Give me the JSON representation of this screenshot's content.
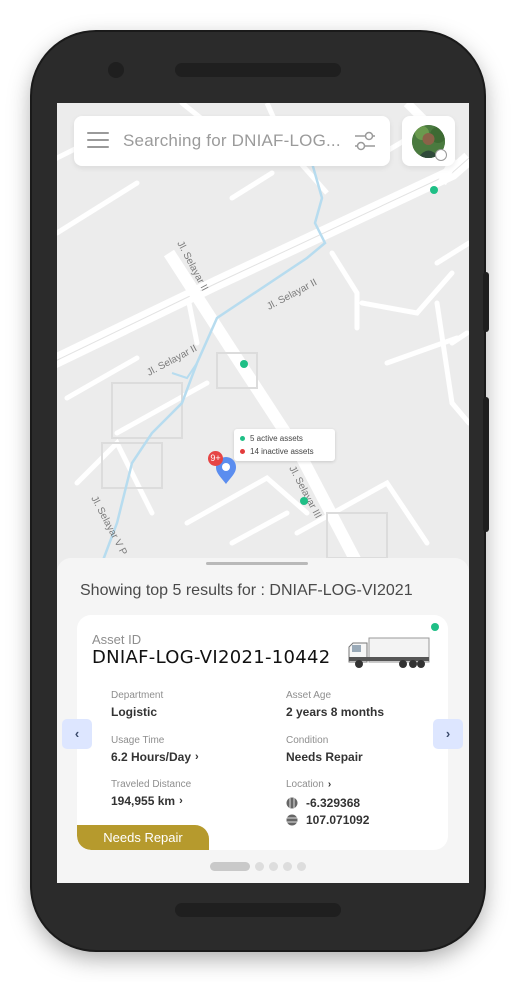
{
  "search": {
    "placeholder": "Searching for DNIAF-LOG..."
  },
  "map": {
    "street_labels": [
      "Jl. Selayar II",
      "Jl. Selayar II",
      "Jl. Selayar II",
      "Jl. Selayar III",
      "Jl. Selayar V P"
    ],
    "tooltip": {
      "active": "5 active assets",
      "inactive": "14 inactive assets"
    },
    "cluster_badge": "9+",
    "colors": {
      "active": "#1fbf86",
      "inactive": "#e23b3b",
      "pin": "#5b8def"
    }
  },
  "results": {
    "title": "Showing top 5 results for : DNIAF-LOG-VI2021",
    "card": {
      "asset_id_label": "Asset ID",
      "asset_id": "DNIAF-LOG-VI2021-10442",
      "department_label": "Department",
      "department": "Logistic",
      "asset_age_label": "Asset Age",
      "asset_age": "2 years 8 months",
      "usage_label": "Usage Time",
      "usage": "6.2 Hours/Day",
      "condition_label": "Condition",
      "condition": "Needs Repair",
      "distance_label": "Traveled Distance",
      "distance": "194,955 km",
      "location_label": "Location",
      "latitude": "-6.329368",
      "longitude": "107.071092",
      "status_badge": "Needs Repair",
      "badge_color": "#b69a2d",
      "status_color": "#1fbf86"
    },
    "pagination": {
      "total": 5,
      "current": 1
    }
  }
}
